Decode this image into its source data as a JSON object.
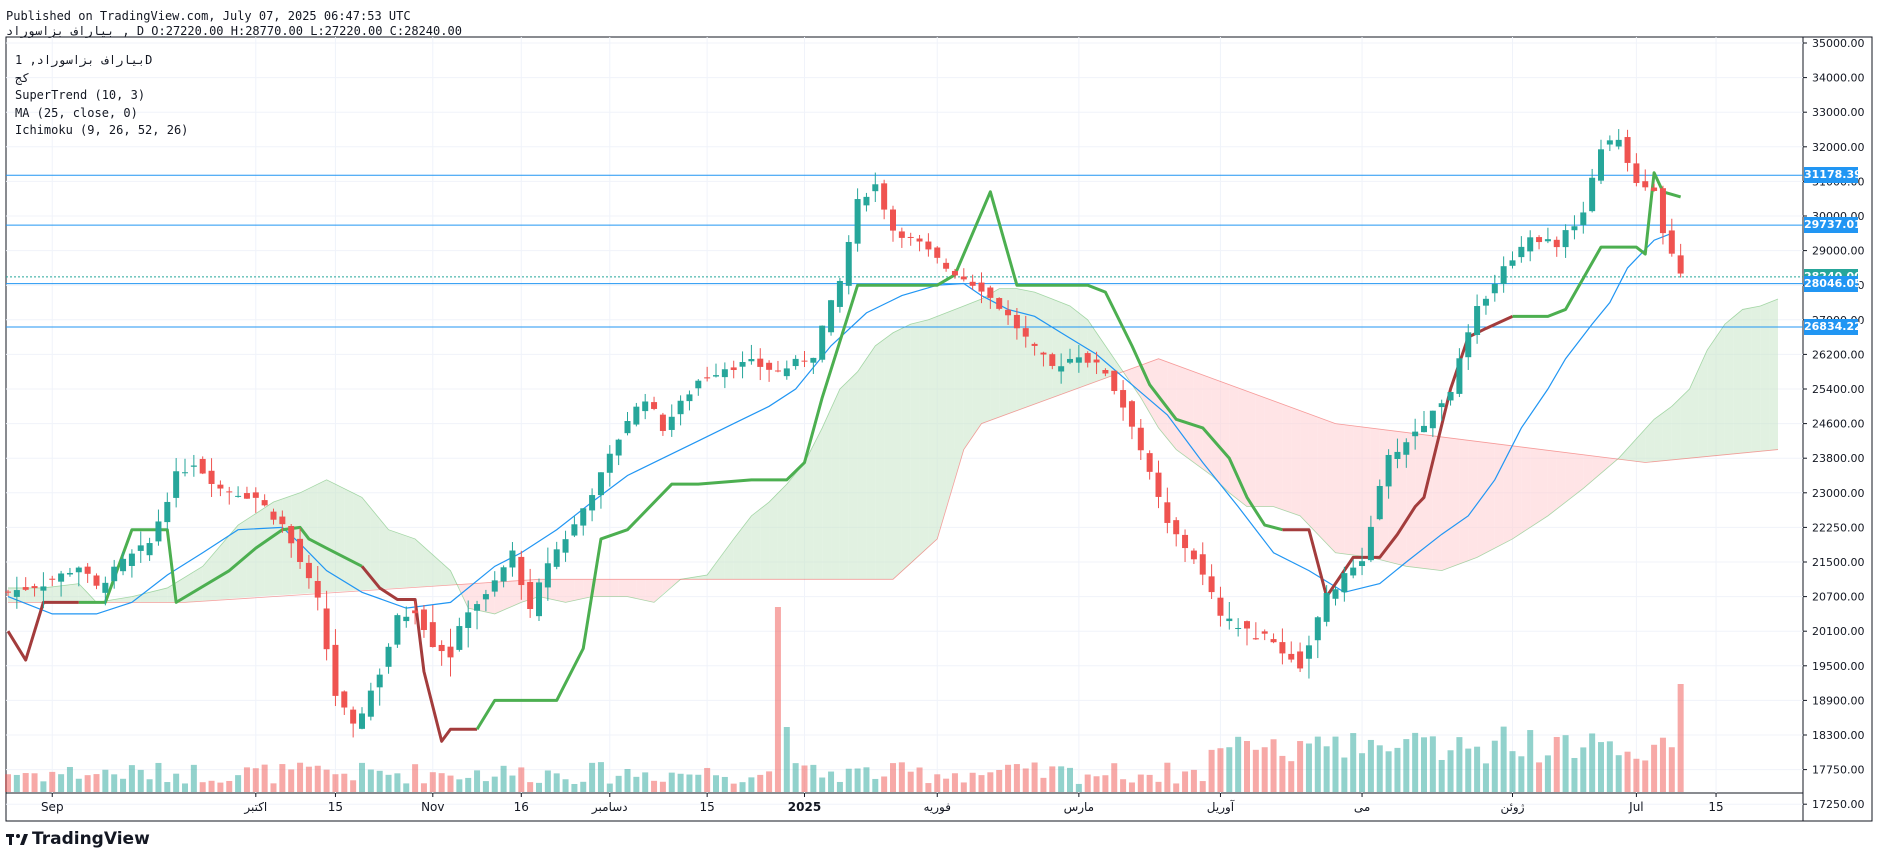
{
  "header": {
    "published": "Published on TradingView.com, July 07, 2025 06:47:53 UTC",
    "symbol": "بیاراف بزاسوراد",
    "ohlc": ", D O:27220.00 H:28770.00 L:27220.00 C:28240.00"
  },
  "legend": {
    "line1": "بیاراف بزاسوراد, 1D",
    "line2": "کج",
    "supertrend": "SuperTrend (10, 3)",
    "ma": "MA (25, close, 0)",
    "ichimoku": "Ichimoku (9, 26, 52, 26)"
  },
  "price_tags": [
    {
      "label": "31178.39",
      "value": 31178.39,
      "color": "#2196f3"
    },
    {
      "label": "29737.01",
      "value": 29737.01,
      "color": "#2196f3"
    },
    {
      "label": "28240.00",
      "value": 28240.0,
      "color": "#26a69a"
    },
    {
      "label": "28046.05",
      "value": 28046.05,
      "color": "#2196f3"
    },
    {
      "label": "26834.22",
      "value": 26834.22,
      "color": "#2196f3"
    }
  ],
  "brand": "TradingView",
  "colors": {
    "up": "#26a69a",
    "down": "#ef5350",
    "supertrend_up": "#4caf50",
    "supertrend_down": "#a33c3c",
    "ma": "#2196f3",
    "hline": "#2196f3",
    "cloud_bull": "#c8e6c9",
    "cloud_bear": "#ffcdd2"
  },
  "chart_data": {
    "type": "candlestick",
    "y_tick_labels": [
      "35000.00",
      "34000.00",
      "33000.00",
      "32000.00",
      "31000.00",
      "30000.00",
      "29000.00",
      "28000.00",
      "27000.00",
      "26200.00",
      "25400.00",
      "24600.00",
      "23800.00",
      "23000.00",
      "22250.00",
      "21500.00",
      "20700.00",
      "20100.00",
      "19500.00",
      "18900.00",
      "18300.00",
      "17750.00",
      "17250.00"
    ],
    "y_tick_values": [
      35000,
      34000,
      33000,
      32000,
      31000,
      30000,
      29000,
      28000,
      27000,
      26200,
      25400,
      24600,
      23800,
      23000,
      22250,
      21500,
      20700,
      20100,
      19500,
      18900,
      18300,
      17750,
      17250
    ],
    "x_tick_labels": [
      "Sep",
      "اکتبر",
      "15",
      "Nov",
      "16",
      "دسامبر",
      "15",
      "2025",
      "فوریه",
      "مارس",
      "آوریل",
      "می",
      "ژوئن",
      "Jul",
      "15"
    ],
    "x_tick_index": [
      5,
      28,
      37,
      48,
      58,
      68,
      79,
      90,
      105,
      121,
      137,
      153,
      170,
      184,
      193
    ],
    "horizontal_levels": [
      31178.39,
      29737.01,
      28046.05,
      26834.22
    ],
    "series": [
      {
        "name": "SuperTrend (10, 3)",
        "kind": "line",
        "x": [
          0,
          2,
          4,
          8,
          11,
          14,
          18,
          19,
          25,
          28,
          31,
          33,
          34,
          36,
          40,
          42,
          44,
          45,
          46,
          47,
          49,
          50,
          53,
          55,
          58,
          62,
          65,
          67,
          70,
          75,
          78,
          84,
          88,
          90,
          92,
          96,
          101,
          105,
          107,
          111,
          114,
          119,
          122,
          124,
          127,
          129,
          132,
          135,
          138,
          140,
          142,
          144,
          146,
          147,
          149,
          152,
          155,
          157,
          159,
          160,
          163,
          165,
          167,
          170,
          172,
          174,
          176,
          180,
          183,
          184,
          185,
          186,
          187,
          189
        ],
        "y": [
          20100,
          19600,
          20600,
          20600,
          20600,
          22200,
          22200,
          20600,
          21300,
          21800,
          22200,
          22250,
          22000,
          21800,
          21400,
          20900,
          20650,
          20650,
          20650,
          19400,
          18200,
          18400,
          18400,
          18900,
          18900,
          18900,
          19800,
          22000,
          22200,
          23200,
          23200,
          23300,
          23300,
          23700,
          25200,
          28000,
          28000,
          28000,
          28300,
          30700,
          28000,
          28000,
          28000,
          27800,
          26400,
          25500,
          24700,
          24500,
          23800,
          22900,
          22300,
          22200,
          22200,
          22200,
          20700,
          21600,
          21600,
          22100,
          22700,
          22900,
          25400,
          26600,
          26800,
          27100,
          27100,
          27100,
          27300,
          29100,
          29100,
          29100,
          28900,
          31250,
          30700,
          30550
        ],
        "segments": [
          {
            "from": 0,
            "to": 3,
            "trend": "down"
          },
          {
            "from": 3,
            "to": 14,
            "trend": "up"
          },
          {
            "from": 14,
            "to": 22,
            "trend": "down"
          },
          {
            "from": 22,
            "to": 51,
            "trend": "up"
          },
          {
            "from": 51,
            "to": 63,
            "trend": "down"
          },
          {
            "from": 63,
            "to": 88,
            "trend": "up"
          },
          {
            "from": 88,
            "to": 89,
            "trend": "down"
          }
        ]
      },
      {
        "name": "MA (25, close, 0)",
        "kind": "line",
        "x": [
          0,
          5,
          10,
          14,
          18,
          22,
          26,
          31,
          33,
          36,
          40,
          45,
          50,
          55,
          58,
          62,
          66,
          70,
          74,
          78,
          82,
          86,
          89,
          93,
          97,
          101,
          105,
          108,
          110,
          113,
          116,
          119,
          123,
          127,
          131,
          135,
          139,
          141,
          143,
          147,
          151,
          155,
          158,
          162,
          165,
          168,
          171,
          174,
          176,
          179,
          181,
          183,
          186,
          188
        ],
        "y": [
          20700,
          20400,
          20400,
          20600,
          21200,
          21700,
          22200,
          22250,
          21900,
          21300,
          20800,
          20500,
          20600,
          21400,
          21700,
          22200,
          22800,
          23400,
          23800,
          24200,
          24600,
          25000,
          25400,
          26400,
          27200,
          27700,
          28000,
          28050,
          27700,
          27300,
          27100,
          26700,
          26200,
          25500,
          24800,
          23700,
          22700,
          22200,
          21700,
          21300,
          20800,
          21000,
          21500,
          22100,
          22500,
          23300,
          24500,
          25400,
          26100,
          26900,
          27500,
          28500,
          29300,
          29500
        ]
      },
      {
        "name": "Ichimoku Senkou A",
        "kind": "line",
        "x": [
          0,
          4,
          8,
          10,
          14,
          18,
          22,
          26,
          30,
          33,
          36,
          40,
          43,
          46,
          50,
          52,
          55,
          58,
          60,
          63,
          66,
          68,
          70,
          73,
          76,
          79,
          82,
          84,
          86,
          88,
          90,
          92,
          94,
          96,
          98,
          100,
          102,
          104,
          106,
          108,
          110,
          112,
          114,
          116,
          118,
          120,
          122,
          124,
          126,
          128,
          130,
          132,
          134,
          136,
          138,
          140,
          143,
          146,
          150,
          154,
          158,
          162,
          166,
          170,
          174,
          178,
          182,
          186,
          188,
          190,
          192,
          194,
          196,
          198,
          200
        ],
        "y": [
          20900,
          20900,
          21000,
          20600,
          20700,
          20900,
          21400,
          22300,
          22800,
          23000,
          23300,
          22900,
          22200,
          22000,
          21300,
          20500,
          20400,
          20600,
          20700,
          20600,
          20700,
          20700,
          20700,
          20600,
          21100,
          21200,
          22000,
          22500,
          22800,
          23200,
          23700,
          24500,
          25400,
          25800,
          26400,
          26700,
          26900,
          27000,
          27200,
          27400,
          27600,
          27900,
          27900,
          27800,
          27600,
          27400,
          27000,
          26400,
          25800,
          25200,
          24500,
          24000,
          23700,
          23400,
          23000,
          22700,
          22700,
          22500,
          21700,
          21600,
          21400,
          21300,
          21600,
          22000,
          22500,
          23100,
          23800,
          24700,
          25000,
          25400,
          26300,
          26900,
          27300,
          27400,
          27600
        ]
      },
      {
        "name": "Ichimoku Senkou B",
        "kind": "line",
        "x": [
          0,
          20,
          60,
          80,
          100,
          105,
          108,
          110,
          130,
          150,
          185,
          190,
          200
        ],
        "y": [
          20600,
          20600,
          21100,
          21100,
          21100,
          22000,
          24000,
          24600,
          26100,
          24600,
          23700,
          23800,
          24000
        ]
      }
    ]
  }
}
